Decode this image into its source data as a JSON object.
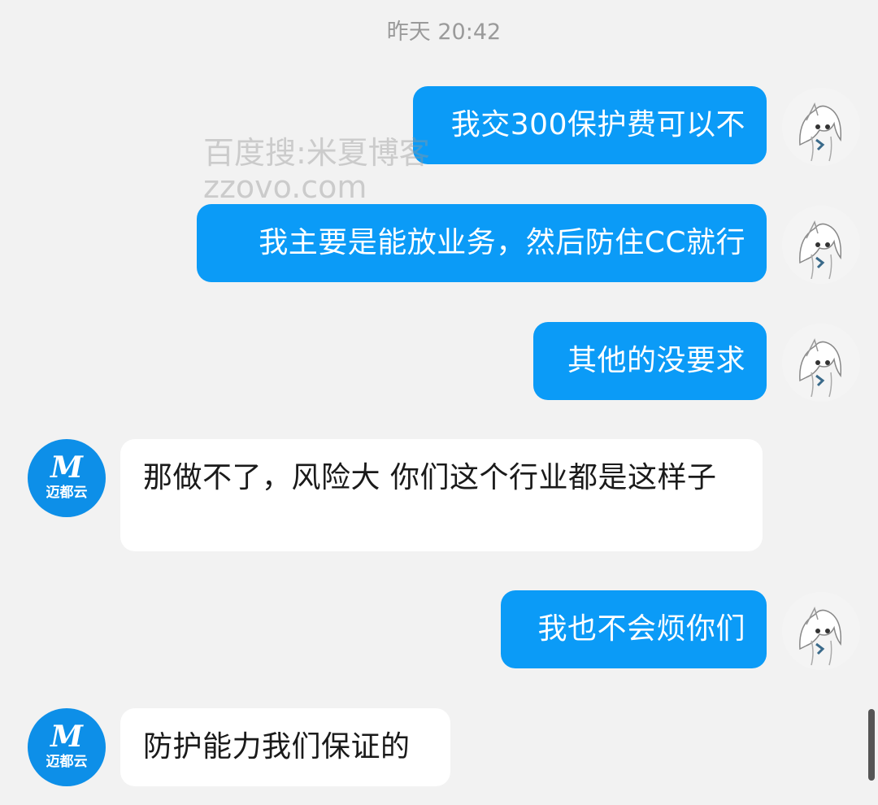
{
  "timestamp": "昨天 20:42",
  "watermark": {
    "line1": "百度搜:米夏博客",
    "line2": "zzovo.com"
  },
  "messages": [
    {
      "sender": "me",
      "text": "我交300保护费可以不"
    },
    {
      "sender": "me",
      "text": "我主要是能放业务，然后防住CC就行"
    },
    {
      "sender": "me",
      "text": "其他的没要求"
    },
    {
      "sender": "other",
      "text": "那做不了，风险大 你们这个行业都是这样子"
    },
    {
      "sender": "me",
      "text": "我也不会烦你们"
    },
    {
      "sender": "other",
      "text": "防护能力我们保证的"
    }
  ],
  "bot_avatar": {
    "logo_letter": "M",
    "logo_text": "迈都云",
    "color": "#0d8fe8"
  },
  "colors": {
    "outgoing_bubble": "#0b9bf7",
    "incoming_bubble": "#ffffff",
    "background": "#f2f2f2"
  }
}
